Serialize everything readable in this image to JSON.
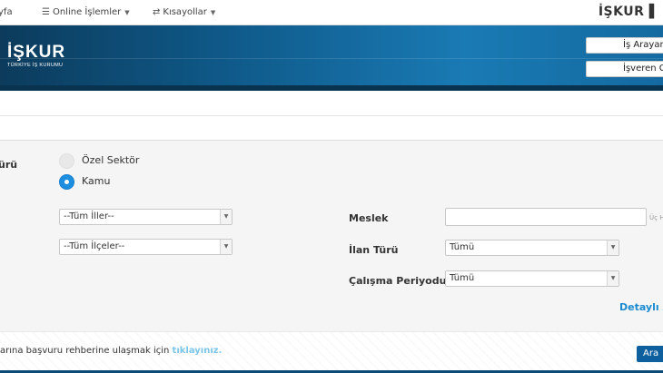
{
  "topnav": {
    "home": "yfa",
    "online": "Online İşlemler",
    "shortcuts": "Kısayollar",
    "brand": "İŞKUR"
  },
  "banner": {
    "logo_main": "İŞKUR",
    "logo_sub": "TÜRKİYE İŞ KURUMU",
    "buttons": [
      "İş Arayan",
      "İşveren Gi"
    ]
  },
  "form": {
    "sector_label": "ürü",
    "sector_options": [
      {
        "label": "Özel Sektör",
        "selected": false
      },
      {
        "label": "Kamu",
        "selected": true
      }
    ],
    "province_select": "--Tüm İller--",
    "district_select": "--Tüm İlçeler--",
    "occupation_label": "Meslek",
    "occupation_value": "",
    "occupation_hint": "Üç H",
    "ad_type_label": "İlan Türü",
    "ad_type_value": "Tümü",
    "period_label": "Çalışma Periyodu",
    "period_value": "Tümü",
    "detailed_link": "Detaylı A"
  },
  "footer": {
    "text": "arına başvuru rehberine ulaşmak için ",
    "link": "tıklayınız.",
    "search_button": "Ara"
  },
  "colors": {
    "accent": "#1e8fe0",
    "banner_dark": "#0c3b5c",
    "button_dark": "#0e5f9e",
    "link": "#1a8bd0"
  }
}
